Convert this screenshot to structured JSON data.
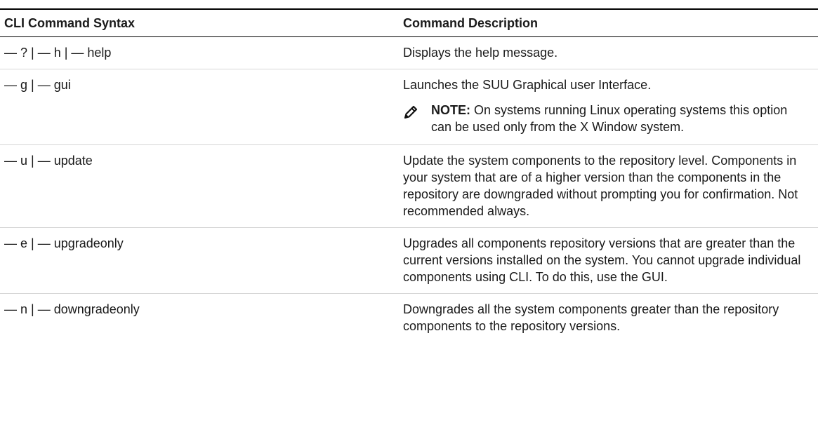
{
  "table": {
    "headers": [
      "CLI Command Syntax",
      "Command Description"
    ],
    "rows": [
      {
        "syntax": "— ? | — h | — help",
        "description": "Displays the help message."
      },
      {
        "syntax": "— g | — gui",
        "description": "Launches the SUU Graphical user Interface.",
        "note": {
          "label": "NOTE:",
          "text": " On systems running Linux operating systems this option can be used only from the X Window system."
        }
      },
      {
        "syntax": "— u | — update",
        "description": "Update the system components to the repository level. Components in your system that are of a higher version than the components in the repository are downgraded without prompting you for confirmation. Not recommended always."
      },
      {
        "syntax": "— e | — upgradeonly",
        "description": "Upgrades all components repository versions that are greater than the current versions installed on the system. You cannot upgrade individual components using CLI. To do this, use the GUI."
      },
      {
        "syntax": "— n | — downgradeonly",
        "description": "Downgrades all the system components greater than the repository components to the repository versions."
      }
    ]
  },
  "icons": {
    "note": "pencil-note-icon"
  }
}
